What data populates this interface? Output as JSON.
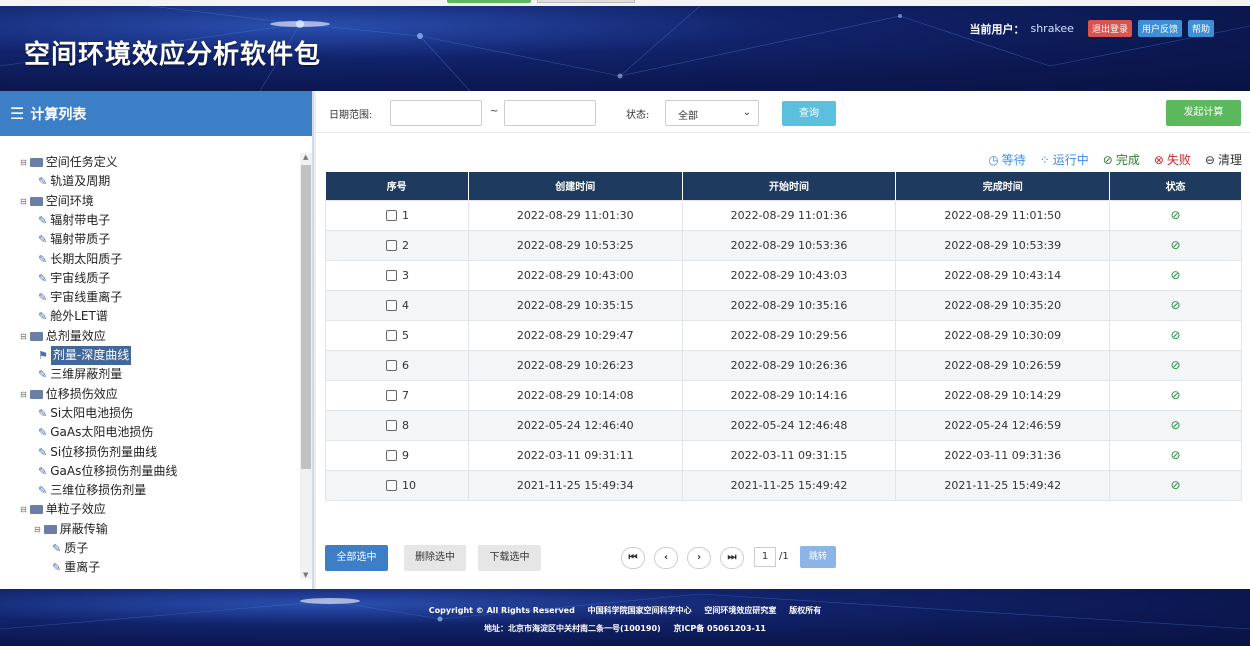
{
  "app": {
    "title": "空间环境效应分析软件包"
  },
  "header": {
    "user_label": "当前用户：",
    "user_name": "shrakee",
    "logout": "退出登录",
    "feedback": "用户反馈",
    "help": "帮助"
  },
  "sidebar": {
    "title": "计算列表",
    "tree": [
      {
        "label": "空间任务定义",
        "type": "folder",
        "level": 0
      },
      {
        "label": "轨道及周期",
        "type": "leaf",
        "level": 1
      },
      {
        "label": "空间环境",
        "type": "folder",
        "level": 0
      },
      {
        "label": "辐射带电子",
        "type": "leaf",
        "level": 1
      },
      {
        "label": "辐射带质子",
        "type": "leaf",
        "level": 1
      },
      {
        "label": "长期太阳质子",
        "type": "leaf",
        "level": 1
      },
      {
        "label": "宇宙线质子",
        "type": "leaf",
        "level": 1
      },
      {
        "label": "宇宙线重离子",
        "type": "leaf",
        "level": 1
      },
      {
        "label": "舱外LET谱",
        "type": "leaf",
        "level": 1
      },
      {
        "label": "总剂量效应",
        "type": "folder",
        "level": 0
      },
      {
        "label": "剂量-深度曲线",
        "type": "leaf",
        "level": 1,
        "selected": true
      },
      {
        "label": "三维屏蔽剂量",
        "type": "leaf",
        "level": 1
      },
      {
        "label": "位移损伤效应",
        "type": "folder",
        "level": 0
      },
      {
        "label": "Si太阳电池损伤",
        "type": "leaf",
        "level": 1
      },
      {
        "label": "GaAs太阳电池损伤",
        "type": "leaf",
        "level": 1
      },
      {
        "label": "Si位移损伤剂量曲线",
        "type": "leaf",
        "level": 1
      },
      {
        "label": "GaAs位移损伤剂量曲线",
        "type": "leaf",
        "level": 1
      },
      {
        "label": "三维位移损伤剂量",
        "type": "leaf",
        "level": 1
      },
      {
        "label": "单粒子效应",
        "type": "folder",
        "level": 0
      },
      {
        "label": "屏蔽传输",
        "type": "folder",
        "level": 1
      },
      {
        "label": "质子",
        "type": "leaf",
        "level": 2
      },
      {
        "label": "重离子",
        "type": "leaf",
        "level": 2
      }
    ]
  },
  "filter": {
    "date_label": "日期范围:",
    "tilde": "~",
    "date_from": "",
    "date_to": "",
    "status_label": "状态:",
    "status_value": "全部",
    "query": "查询",
    "submit": "发起计算"
  },
  "legend": {
    "wait": "等待",
    "running": "运行中",
    "done": "完成",
    "fail": "失败",
    "clear": "清理"
  },
  "table": {
    "headers": [
      "序号",
      "创建时间",
      "开始时间",
      "完成时间",
      "状态"
    ],
    "rows": [
      {
        "no": "1",
        "created": "2022-08-29 11:01:30",
        "started": "2022-08-29 11:01:36",
        "finished": "2022-08-29 11:01:50",
        "status": "完成"
      },
      {
        "no": "2",
        "created": "2022-08-29 10:53:25",
        "started": "2022-08-29 10:53:36",
        "finished": "2022-08-29 10:53:39",
        "status": "完成"
      },
      {
        "no": "3",
        "created": "2022-08-29 10:43:00",
        "started": "2022-08-29 10:43:03",
        "finished": "2022-08-29 10:43:14",
        "status": "完成"
      },
      {
        "no": "4",
        "created": "2022-08-29 10:35:15",
        "started": "2022-08-29 10:35:16",
        "finished": "2022-08-29 10:35:20",
        "status": "完成"
      },
      {
        "no": "5",
        "created": "2022-08-29 10:29:47",
        "started": "2022-08-29 10:29:56",
        "finished": "2022-08-29 10:30:09",
        "status": "完成"
      },
      {
        "no": "6",
        "created": "2022-08-29 10:26:23",
        "started": "2022-08-29 10:26:36",
        "finished": "2022-08-29 10:26:59",
        "status": "完成"
      },
      {
        "no": "7",
        "created": "2022-08-29 10:14:08",
        "started": "2022-08-29 10:14:16",
        "finished": "2022-08-29 10:14:29",
        "status": "完成"
      },
      {
        "no": "8",
        "created": "2022-05-24 12:46:40",
        "started": "2022-05-24 12:46:48",
        "finished": "2022-05-24 12:46:59",
        "status": "完成"
      },
      {
        "no": "9",
        "created": "2022-03-11 09:31:11",
        "started": "2022-03-11 09:31:15",
        "finished": "2022-03-11 09:31:36",
        "status": "完成"
      },
      {
        "no": "10",
        "created": "2021-11-25 15:49:34",
        "started": "2021-11-25 15:49:42",
        "finished": "2021-11-25 15:49:42",
        "status": "完成"
      }
    ]
  },
  "actions": {
    "select_all": "全部选中",
    "delete_selected": "删除选中",
    "download_selected": "下载选中"
  },
  "pager": {
    "first": "⏮",
    "prev": "‹",
    "next": "›",
    "last": "⏭",
    "page": "1",
    "total": "/1",
    "go": "跳转"
  },
  "footer": {
    "copyright": "Copyright © All Rights Reserved",
    "center": "中国科学院国家空间科学中心",
    "lab": "空间环境效应研究室",
    "rights": "版权所有",
    "address": "地址：北京市海淀区中关村南二条一号(100190)",
    "icp": "京ICP备 05061203-11"
  },
  "colors": {
    "header_bg": "#0b174f",
    "sidebar_head": "#3c7fc6",
    "table_head": "#1e3a5f",
    "submit_green": "#5cb85c",
    "query_blue": "#5bc0de",
    "done_green": "#1e8e3e"
  }
}
